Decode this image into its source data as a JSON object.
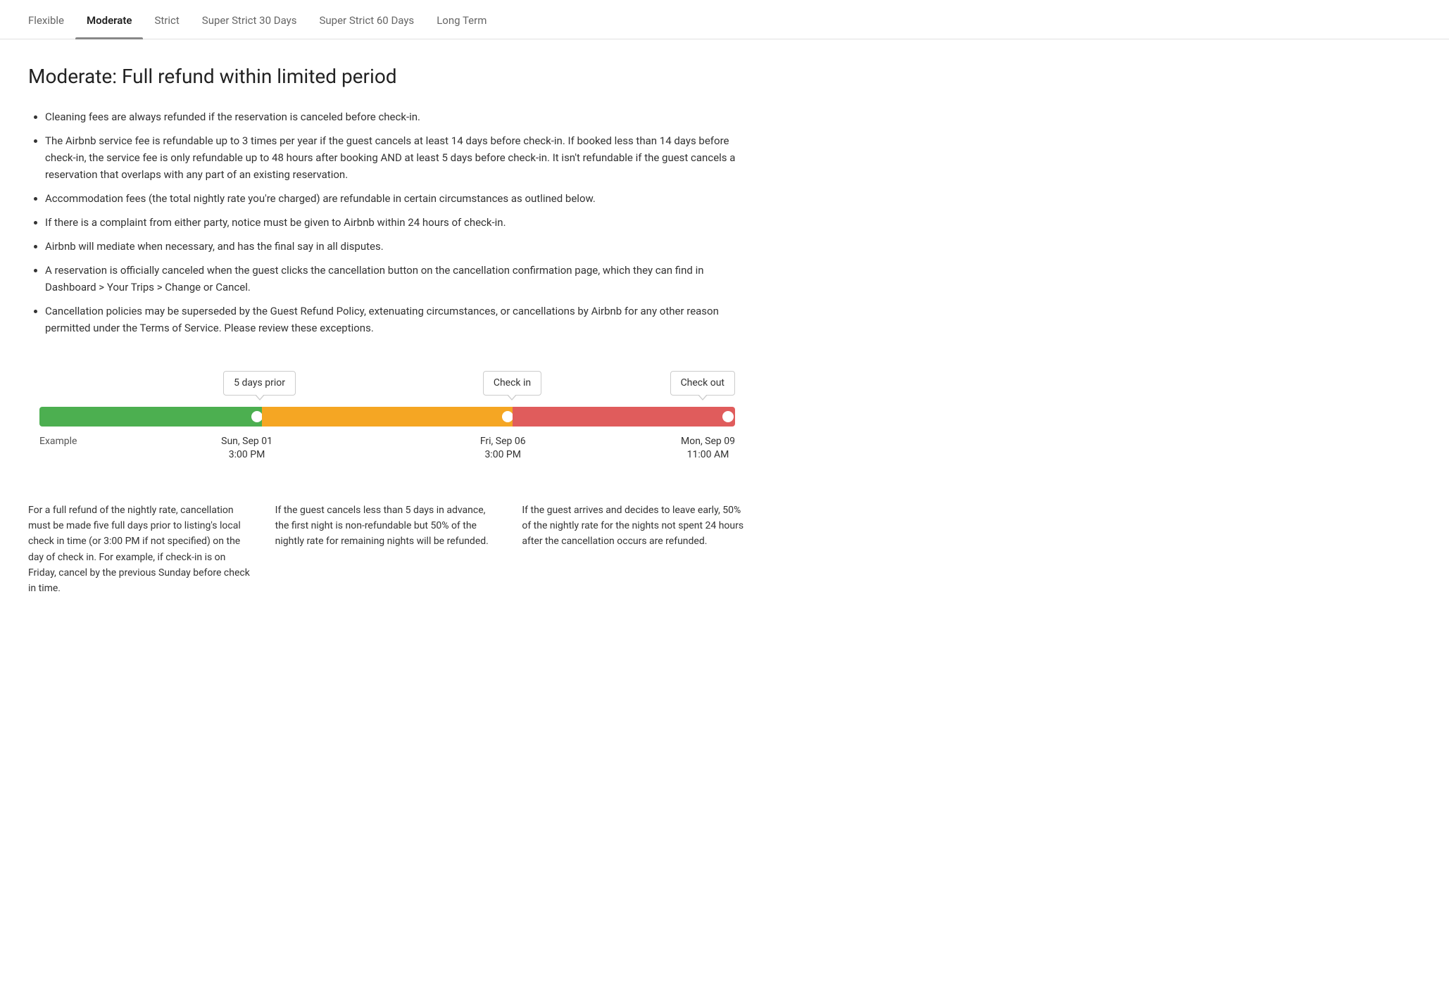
{
  "tabs": [
    {
      "id": "flexible",
      "label": "Flexible",
      "active": false
    },
    {
      "id": "moderate",
      "label": "Moderate",
      "active": true
    },
    {
      "id": "strict",
      "label": "Strict",
      "active": false
    },
    {
      "id": "super-strict-30",
      "label": "Super Strict 30 Days",
      "active": false
    },
    {
      "id": "super-strict-60",
      "label": "Super Strict 60 Days",
      "active": false
    },
    {
      "id": "long-term",
      "label": "Long Term",
      "active": false
    }
  ],
  "page": {
    "title": "Moderate: Full refund within limited period",
    "bullets": [
      "Cleaning fees are always refunded if the reservation is canceled before check-in.",
      "The Airbnb service fee is refundable up to 3 times per year if the guest cancels at least 14 days before check-in. If booked less than 14 days before check-in, the service fee is only refundable up to 48 hours after booking AND at least 5 days before check-in. It isn't refundable if the guest cancels a reservation that overlaps with any part of an existing reservation.",
      "Accommodation fees (the total nightly rate you're charged) are refundable in certain circumstances as outlined below.",
      "If there is a complaint from either party, notice must be given to Airbnb within 24 hours of check-in.",
      "Airbnb will mediate when necessary, and has the final say in all disputes.",
      "A reservation is officially canceled when the guest clicks the cancellation button on the cancellation confirmation page, which they can find in Dashboard > Your Trips > Change or Cancel.",
      "Cancellation policies may be superseded by the Guest Refund Policy, extenuating circumstances, or cancellations by Airbnb for any other reason permitted under the Terms of Service. Please review these exceptions."
    ]
  },
  "timeline": {
    "label_5days": "5 days prior",
    "label_checkin": "Check in",
    "label_checkout": "Check out",
    "example_label": "Example",
    "date1_line1": "Sun, Sep 01",
    "date1_line2": "3:00 PM",
    "date2_line1": "Fri, Sep 06",
    "date2_line2": "3:00 PM",
    "date3_line1": "Mon, Sep 09",
    "date3_line2": "11:00 AM"
  },
  "descriptions": {
    "col1": "For a full refund of the nightly rate, cancellation must be made five full days prior to listing's local check in time (or 3:00 PM if not specified) on the day of check in. For example, if check-in is on Friday, cancel by the previous Sunday before check in time.",
    "col2": "If the guest cancels less than 5 days in advance, the first night is non-refundable but 50% of the nightly rate for remaining nights will be refunded.",
    "col3": "If the guest arrives and decides to leave early, 50% of the nightly rate for the nights not spent 24 hours after the cancellation occurs are refunded."
  }
}
